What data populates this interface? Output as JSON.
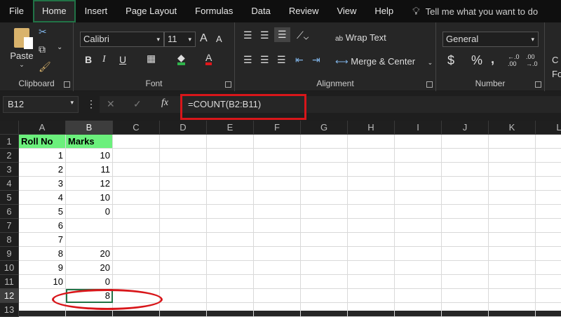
{
  "menu": {
    "tabs": [
      "File",
      "Home",
      "Insert",
      "Page Layout",
      "Formulas",
      "Data",
      "Review",
      "View",
      "Help"
    ],
    "active": "Home",
    "tell_me": "Tell me what you want to do"
  },
  "ribbon": {
    "clipboard": {
      "paste": "Paste",
      "label": "Clipboard"
    },
    "font": {
      "name": "Calibri",
      "size": "11",
      "bold": "B",
      "italic": "I",
      "underline": "U",
      "grow": "A",
      "shrink": "A",
      "color_letter": "A",
      "label": "Font",
      "fill_color": "#2fb34a",
      "font_color": "#e0161a"
    },
    "alignment": {
      "wrap": "Wrap Text",
      "merge": "Merge & Center",
      "label": "Alignment"
    },
    "number": {
      "format": "General",
      "dollar": "$",
      "percent": "%",
      "comma": ",",
      "inc": "←.0 .00",
      "dec": ".00 →.0",
      "label": "Number"
    },
    "cond": "C Fo"
  },
  "formula_bar": {
    "name_box": "B12",
    "fx": "fx",
    "formula": "=COUNT(B2:B11)"
  },
  "sheet": {
    "columns": [
      "A",
      "B",
      "C",
      "D",
      "E",
      "F",
      "G",
      "H",
      "I",
      "J",
      "K",
      "L"
    ],
    "selected_column": "B",
    "selected_row": 12,
    "active_cell": "B12",
    "rows": [
      [
        "Roll No",
        "Marks"
      ],
      [
        "1",
        "10"
      ],
      [
        "2",
        "11"
      ],
      [
        "3",
        "12"
      ],
      [
        "4",
        "10"
      ],
      [
        "5",
        "0"
      ],
      [
        "6",
        ""
      ],
      [
        "7",
        ""
      ],
      [
        "8",
        "20"
      ],
      [
        "9",
        "20"
      ],
      [
        "10",
        "0"
      ],
      [
        "",
        "8"
      ],
      [
        "",
        ""
      ]
    ],
    "header_fill": "#6bf07c",
    "annotation_color": "#d8161a"
  }
}
